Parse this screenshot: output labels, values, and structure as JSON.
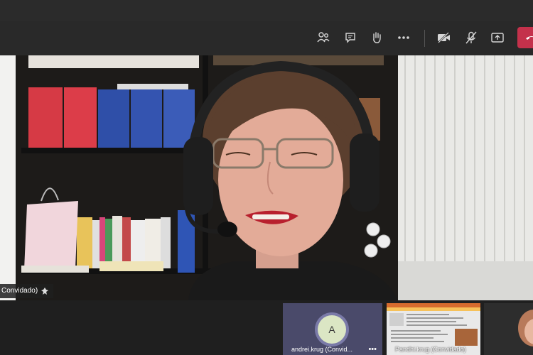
{
  "toolbar": {
    "icons": [
      "participants-icon",
      "chat-icon",
      "raise-hand-icon",
      "more-icon",
      "camera-off-icon",
      "mic-off-icon",
      "share-screen-icon",
      "leave-call-icon"
    ]
  },
  "main_video": {
    "name_label": "Convidado)"
  },
  "participants": [
    {
      "initial": "A",
      "label": "andrei.krug (Convid...",
      "more": "•••"
    },
    {
      "label": "Pandhi.krug (Convidado)"
    }
  ],
  "colors": {
    "accent": "#c4314b",
    "avatar_bg": "#dbe6c4",
    "avatar_ring": "#7a7aa8"
  }
}
